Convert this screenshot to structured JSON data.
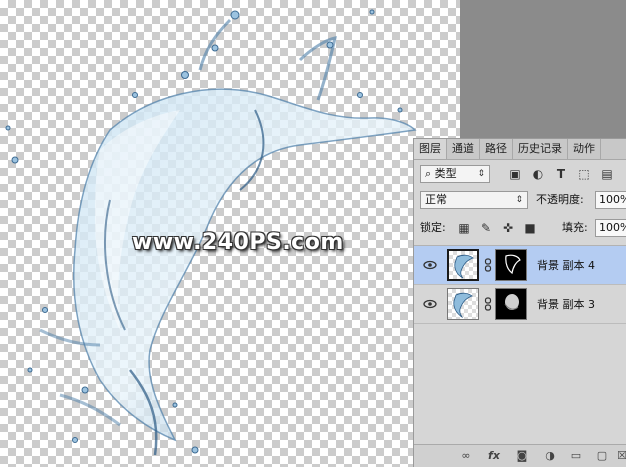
{
  "watermark": "www.240PS.com",
  "panel": {
    "tabs": [
      {
        "label": "图层",
        "active": true
      },
      {
        "label": "通道",
        "active": false
      },
      {
        "label": "路径",
        "active": false
      },
      {
        "label": "历史记录",
        "active": false
      },
      {
        "label": "动作",
        "active": false
      }
    ],
    "filter": {
      "value": "类型",
      "search_icon": "search-icon"
    },
    "filter_icons": [
      "image-filter-icon",
      "adjustment-filter-icon",
      "type-filter-icon",
      "shape-filter-icon",
      "smart-object-filter-icon"
    ],
    "blend_mode": "正常",
    "opacity_label": "不透明度:",
    "opacity_value": "100%",
    "lock_label": "锁定:",
    "lock_icons": [
      "lock-transparent-icon",
      "lock-paint-icon",
      "lock-position-icon",
      "lock-all-icon"
    ],
    "fill_label": "填充:",
    "fill_value": "100%",
    "layers": [
      {
        "name": "背景 副本 4",
        "visible": true,
        "selected": true
      },
      {
        "name": "背景 副本 3",
        "visible": true,
        "selected": false
      }
    ],
    "bottom_icons": [
      "link-icon",
      "fx-icon",
      "mask-icon",
      "adjustment-icon",
      "group-folder-icon",
      "new-layer-icon",
      "trash-icon"
    ],
    "fx_label": "fx"
  },
  "colors": {
    "selected_layer": "#b4ccf2",
    "pasteboard": "#8b8b8b",
    "panel_bg": "#d6d6d6"
  }
}
